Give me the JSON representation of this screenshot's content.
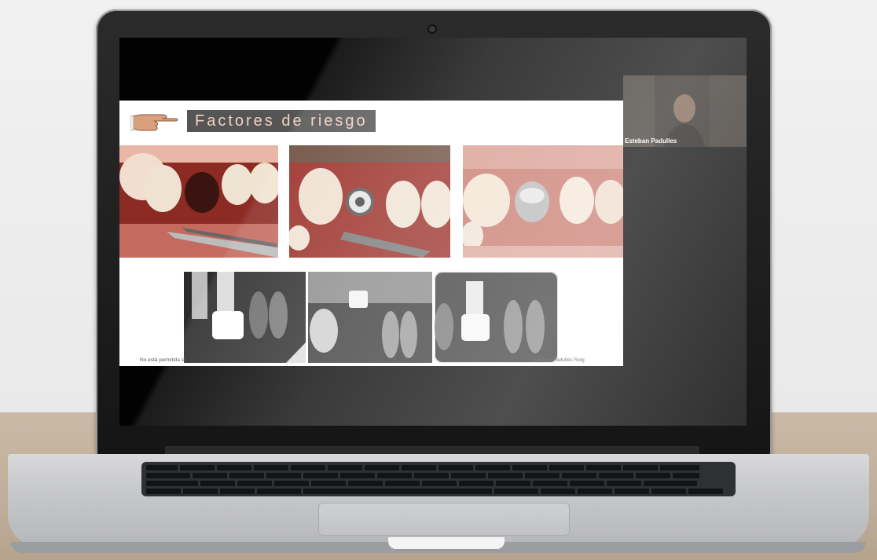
{
  "slide": {
    "title": "Factores de riesgo",
    "footer_left": "No está permitida la",
    "footer_right": "Esteban Padullés Roig"
  },
  "webcam": {
    "participant_name": "Esteban Padulles"
  },
  "icons": {
    "pointer": "pointing-hand-icon"
  }
}
